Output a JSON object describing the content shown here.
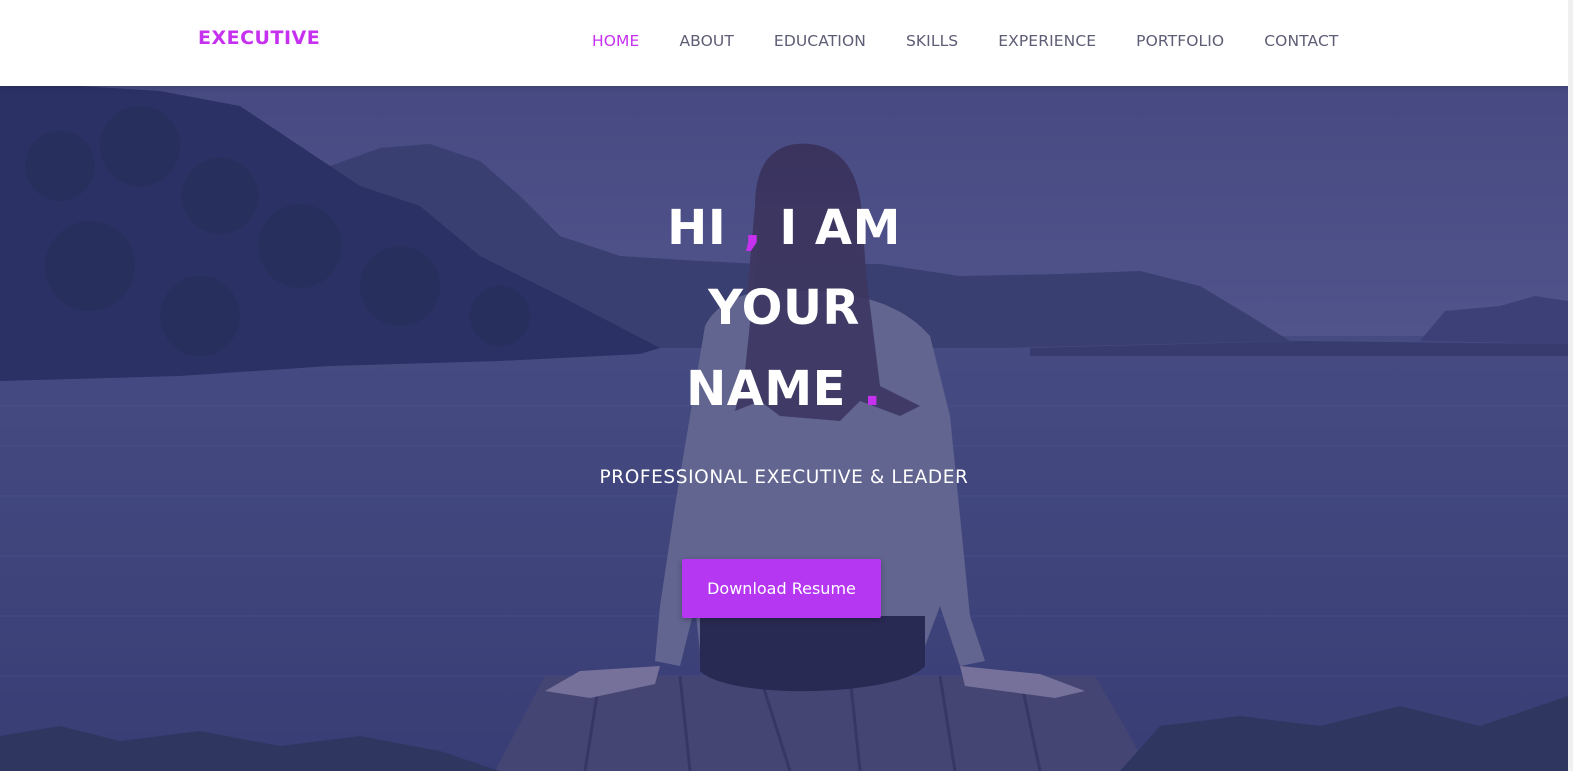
{
  "brand": "EXECUTIVE",
  "nav": [
    {
      "label": "HOME",
      "active": true
    },
    {
      "label": "ABOUT",
      "active": false
    },
    {
      "label": "EDUCATION",
      "active": false
    },
    {
      "label": "SKILLS",
      "active": false
    },
    {
      "label": "EXPERIENCE",
      "active": false
    },
    {
      "label": "PORTFOLIO",
      "active": false
    },
    {
      "label": "CONTACT",
      "active": false
    }
  ],
  "hero": {
    "line1_a": "HI",
    "line1_comma": ",",
    "line1_b": "I AM",
    "line2": "YOUR",
    "line3": "NAME",
    "line3_dot": ".",
    "subtitle": "PROFESSIONAL EXECUTIVE & LEADER",
    "cta_label": "Download Resume",
    "background_image": "woman-sitting-on-dock-by-lake"
  },
  "colors": {
    "accent": "#c631f0",
    "button": "#b537f2",
    "nav_text": "#5d5d75",
    "overlay": "#302d78"
  }
}
